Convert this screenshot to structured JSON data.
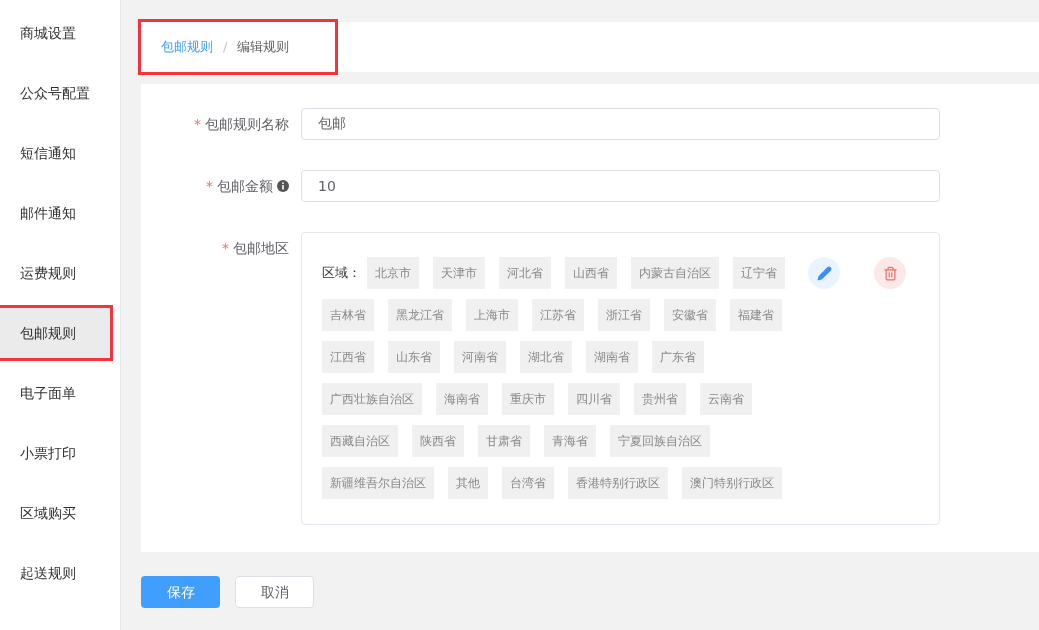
{
  "sidebar": {
    "items": [
      {
        "label": "商城设置",
        "selected": false,
        "highlighted": false
      },
      {
        "label": "公众号配置",
        "selected": false,
        "highlighted": false
      },
      {
        "label": "短信通知",
        "selected": false,
        "highlighted": false
      },
      {
        "label": "邮件通知",
        "selected": false,
        "highlighted": false
      },
      {
        "label": "运费规则",
        "selected": false,
        "highlighted": false
      },
      {
        "label": "包邮规则",
        "selected": true,
        "highlighted": true
      },
      {
        "label": "电子面单",
        "selected": false,
        "highlighted": false
      },
      {
        "label": "小票打印",
        "selected": false,
        "highlighted": false
      },
      {
        "label": "区域购买",
        "selected": false,
        "highlighted": false
      },
      {
        "label": "起送规则",
        "selected": false,
        "highlighted": false
      }
    ]
  },
  "breadcrumb": {
    "highlighted": true,
    "items": [
      "包邮规则",
      "编辑规则"
    ],
    "separator": "/"
  },
  "form": {
    "fields": [
      {
        "kind": "input",
        "required_mark": "*",
        "label": "包邮规则名称",
        "value": "包邮",
        "info": false
      },
      {
        "kind": "input",
        "required_mark": "*",
        "label": "包邮金额",
        "value": "10",
        "info": true
      },
      {
        "kind": "regions",
        "required_mark": "*",
        "label": "包邮地区",
        "region_label": "区域：",
        "regions": [
          "北京市",
          "天津市",
          "河北省",
          "山西省",
          "内蒙古自治区",
          "辽宁省",
          "吉林省",
          "黑龙江省",
          "上海市",
          "江苏省",
          "浙江省",
          "安徽省",
          "福建省",
          "江西省",
          "山东省",
          "河南省",
          "湖北省",
          "湖南省",
          "广东省",
          "广西壮族自治区",
          "海南省",
          "重庆市",
          "四川省",
          "贵州省",
          "云南省",
          "西藏自治区",
          "陕西省",
          "甘肃省",
          "青海省",
          "宁夏回族自治区",
          "新疆维吾尔自治区",
          "其他",
          "台湾省",
          "香港特别行政区",
          "澳门特别行政区"
        ]
      }
    ]
  },
  "buttons": [
    {
      "kind": "primary",
      "label": "保存"
    },
    {
      "kind": "default",
      "label": "取消"
    }
  ]
}
